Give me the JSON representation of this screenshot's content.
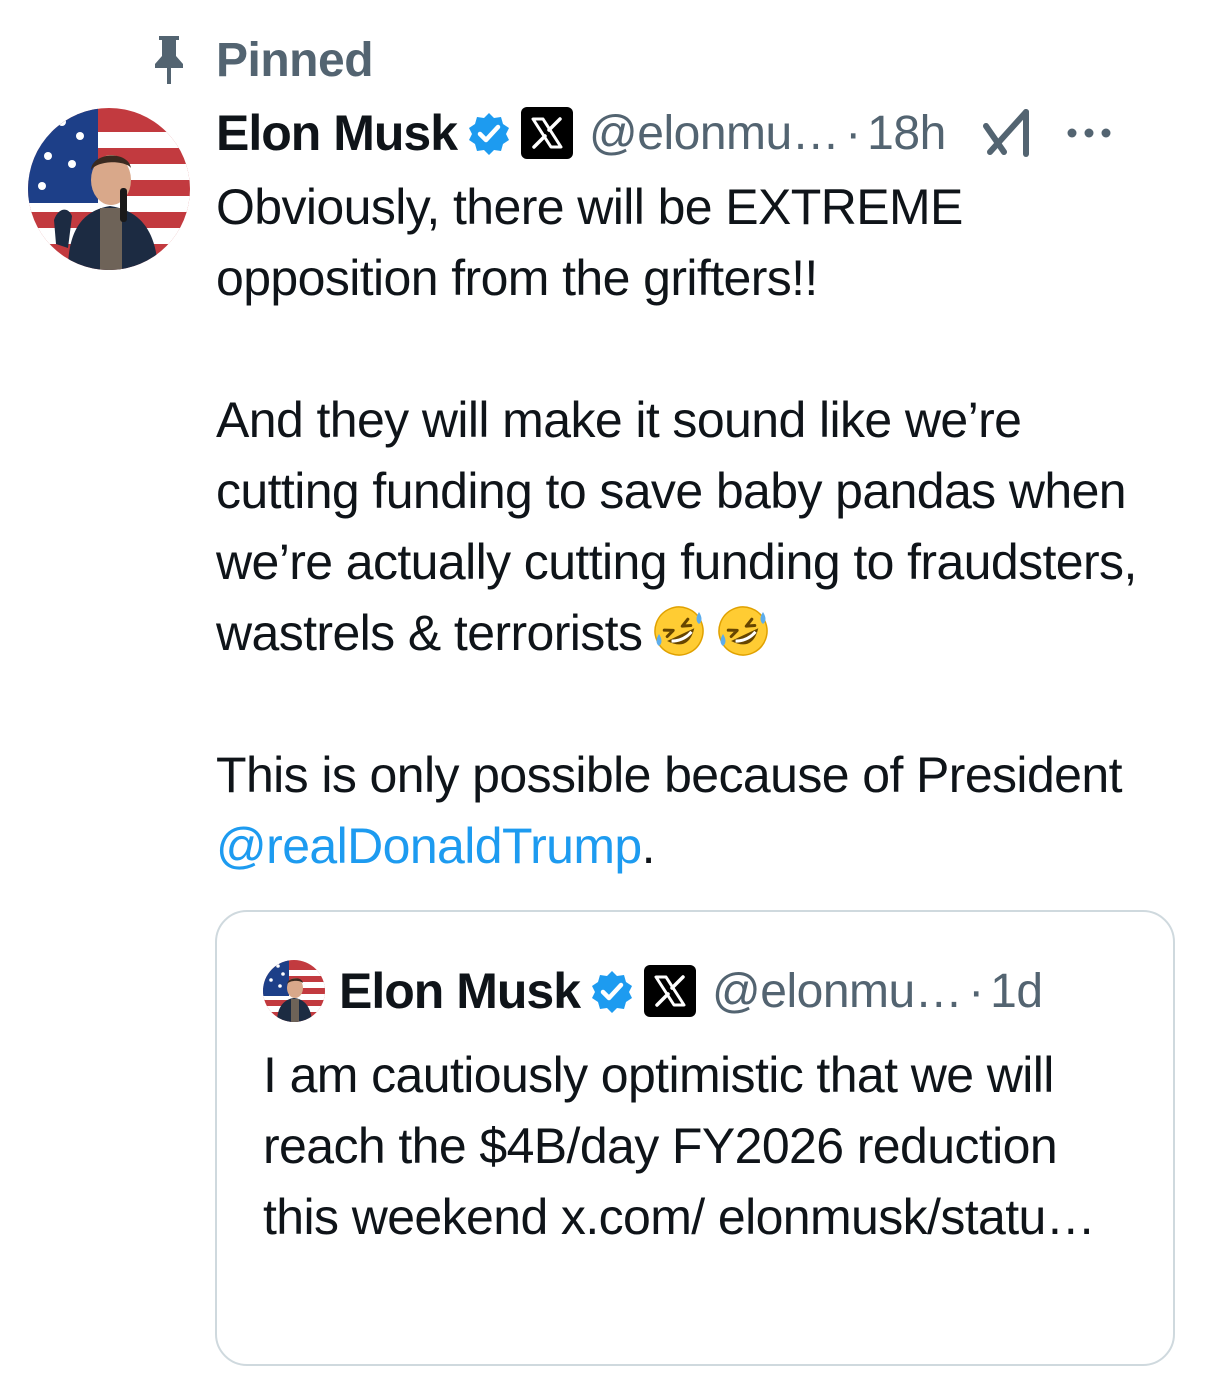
{
  "pinned": {
    "label": "Pinned",
    "icon": "pin-icon"
  },
  "tweet": {
    "author_name": "Elon Musk",
    "handle": "@elonmu…",
    "separator": "·",
    "timestamp": "18h",
    "icons": [
      "verified-icon",
      "x-affiliate-badge",
      "grok-icon",
      "more-icon"
    ],
    "paragraphs": [
      "Obviously, there will be EXTREME opposition from the grifters!!",
      "And they will make it sound like we’re cutting funding to save baby pandas when we’re actually cutting funding to fraudsters, wastrels & terrorists",
      "This is only possible because of President"
    ],
    "emoji": "🤣",
    "mention": "@realDonaldTrump",
    "trailing": "."
  },
  "quoted_tweet": {
    "author_name": "Elon Musk",
    "handle": "@elonmu…",
    "separator": "·",
    "timestamp": "1d",
    "text": "I am cautiously optimistic that we will reach the $4B/day FY2026 reduction this weekend x.com/ elonmusk/statu…"
  },
  "colors": {
    "text": "#0f1419",
    "secondary": "#536471",
    "link": "#1d9bf0",
    "verified": "#1d9bf0",
    "border": "#cfd9de"
  }
}
